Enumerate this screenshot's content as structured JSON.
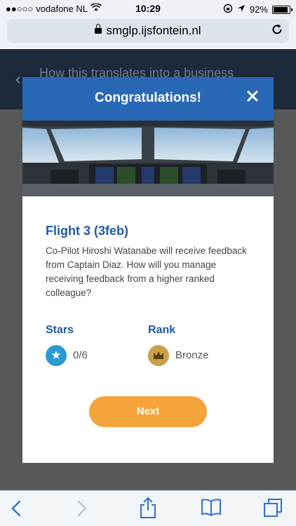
{
  "status_bar": {
    "carrier": "vodafone NL",
    "time": "10:29",
    "battery": "92%",
    "battery_level": 0.92
  },
  "browser": {
    "url": "smglp.ijsfontein.nl"
  },
  "background_page": {
    "title": "How this translates into a business"
  },
  "modal": {
    "title": "Congratulations!",
    "flight_title": "Flight 3 (3feb)",
    "description": "Co-Pilot Hiroshi Watanabe will receive feedback from Captain Diaz. How will you manage receiving feedback from a higher ranked colleague?",
    "stars_label": "Stars",
    "stars_value": "0/6",
    "rank_label": "Rank",
    "rank_value": "Bronze",
    "next_label": "Next"
  }
}
